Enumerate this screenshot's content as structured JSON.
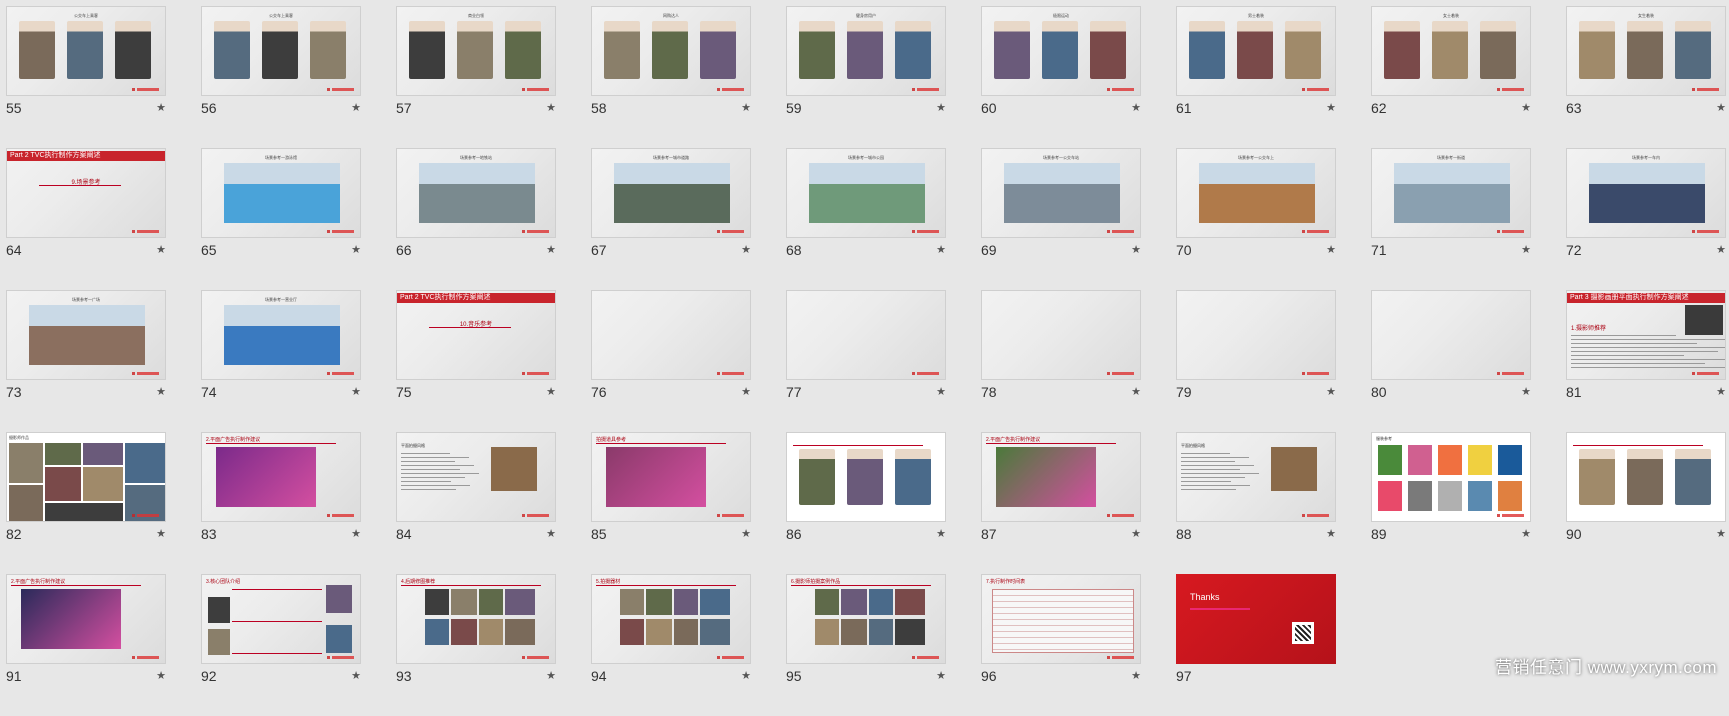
{
  "slides": [
    {
      "num": "55",
      "kind": "people3",
      "title": "公交车上乘客"
    },
    {
      "num": "56",
      "kind": "people3",
      "title": "公交车上乘客"
    },
    {
      "num": "57",
      "kind": "people3",
      "title": "商业白领"
    },
    {
      "num": "58",
      "kind": "people3",
      "title": "网购达人"
    },
    {
      "num": "59",
      "kind": "people3",
      "title": "健身房用户"
    },
    {
      "num": "60",
      "kind": "people3",
      "title": "极限运动"
    },
    {
      "num": "61",
      "kind": "people3",
      "title": "男士着装"
    },
    {
      "num": "62",
      "kind": "people3",
      "title": "女士着装"
    },
    {
      "num": "63",
      "kind": "people3",
      "title": "女生着装"
    },
    {
      "num": "64",
      "kind": "section",
      "bar": "Part 2 TVC执行制作方案阐述",
      "label": "9.场景参考"
    },
    {
      "num": "65",
      "kind": "scene",
      "title": "场景参考一游泳馆",
      "color": "#4aa3d9"
    },
    {
      "num": "66",
      "kind": "scene",
      "title": "场景参考一地铁站",
      "color": "#7a8a8f"
    },
    {
      "num": "67",
      "kind": "scene",
      "title": "场景参考一城市道路",
      "color": "#5a6b5c"
    },
    {
      "num": "68",
      "kind": "scene",
      "title": "场景参考一城市公园",
      "color": "#6f9a7a"
    },
    {
      "num": "69",
      "kind": "scene",
      "title": "场景参考一公交车站",
      "color": "#7d8c99"
    },
    {
      "num": "70",
      "kind": "scene",
      "title": "场景参考一公交车上",
      "color": "#b07a4a"
    },
    {
      "num": "71",
      "kind": "scene",
      "title": "场景参考一街道",
      "color": "#8aa0b0"
    },
    {
      "num": "72",
      "kind": "scene",
      "title": "场景参考一车内",
      "color": "#3a4a6a"
    },
    {
      "num": "73",
      "kind": "scene",
      "title": "场景参考一广场",
      "color": "#8b6f5f"
    },
    {
      "num": "74",
      "kind": "scene",
      "title": "场景参考一营业厅",
      "color": "#3a7ac0"
    },
    {
      "num": "75",
      "kind": "section",
      "bar": "Part 2 TVC执行制作方案阐述",
      "label": "10.音乐参考"
    },
    {
      "num": "76",
      "kind": "blank"
    },
    {
      "num": "77",
      "kind": "blank"
    },
    {
      "num": "78",
      "kind": "blank"
    },
    {
      "num": "79",
      "kind": "blank"
    },
    {
      "num": "80",
      "kind": "blank"
    },
    {
      "num": "81",
      "kind": "textslide",
      "bar": "Part 3 摄影画册平面执行制作方案阐述",
      "label": "1.摄影师推荐"
    },
    {
      "num": "82",
      "kind": "collage",
      "title": "摄影师作品"
    },
    {
      "num": "83",
      "kind": "poster",
      "label": "2.平面广告执行制作建议",
      "color": "#7b2a8a"
    },
    {
      "num": "84",
      "kind": "textpic",
      "label": "平面拍摄风格"
    },
    {
      "num": "85",
      "kind": "poster",
      "label": "拍摄道具参考",
      "color": "#8a3a6a"
    },
    {
      "num": "86",
      "kind": "people3w",
      "label": "模特形象"
    },
    {
      "num": "87",
      "kind": "poster",
      "label": "2.平面广告执行制作建议",
      "color": "#4a7a3a"
    },
    {
      "num": "88",
      "kind": "textpic",
      "label": "平面拍摄风格"
    },
    {
      "num": "89",
      "kind": "clothes",
      "label": "服装参考"
    },
    {
      "num": "90",
      "kind": "people3w",
      "label": "模特形象"
    },
    {
      "num": "91",
      "kind": "poster",
      "label": "2.平面广告执行制作建议",
      "color": "#2a2a5a"
    },
    {
      "num": "92",
      "kind": "team",
      "label": "3.核心团队介绍"
    },
    {
      "num": "93",
      "kind": "gallery",
      "label": "4.后期修图推荐"
    },
    {
      "num": "94",
      "kind": "gallery",
      "label": "5.拍摄器材"
    },
    {
      "num": "95",
      "kind": "gallery",
      "label": "6.摄影师拍摄案例作品"
    },
    {
      "num": "96",
      "kind": "table",
      "label": "7.执行制作时间表"
    },
    {
      "num": "97",
      "kind": "thanks",
      "label": "Thanks"
    }
  ],
  "star_glyph": "★",
  "watermark": "营销任意门 www.yxrym.com"
}
